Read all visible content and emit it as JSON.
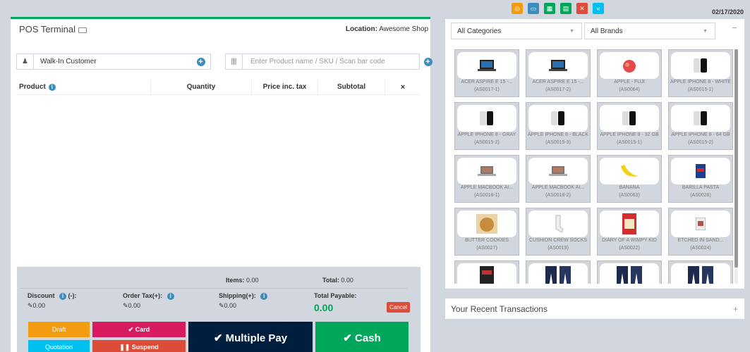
{
  "topbar": {
    "date": "02/17/2020",
    "icons": [
      {
        "name": "calculator-circle-icon",
        "color": "#f39c12",
        "glyph": "◎"
      },
      {
        "name": "window-icon",
        "color": "#3c8dbc",
        "glyph": "▭"
      },
      {
        "name": "calculator-icon",
        "color": "#00a65a",
        "glyph": "▦"
      },
      {
        "name": "briefcase-icon",
        "color": "#00a65a",
        "glyph": "▤"
      },
      {
        "name": "close-window-icon",
        "color": "#dd4b39",
        "glyph": "✕"
      },
      {
        "name": "backward-icon",
        "color": "#00c0ef",
        "glyph": "«"
      }
    ]
  },
  "pos": {
    "title": "POS Terminal",
    "location_label": "Location:",
    "location_value": "Awesome Shop",
    "customer": {
      "value": "Walk-In Customer"
    },
    "product_search": {
      "placeholder": "Enter Product name / SKU / Scan bar code"
    },
    "table_headers": [
      "Product",
      "Quantity",
      "Price inc. tax",
      "Subtotal",
      "×"
    ],
    "items_label": "Items:",
    "items_value": "0.00",
    "total_label": "Total:",
    "total_value": "0.00",
    "discount_label": "Discount",
    "discount_suffix": "(-):",
    "discount_value": "0.00",
    "order_tax_label": "Order Tax(+):",
    "order_tax_value": "0.00",
    "shipping_label": "Shipping(+):",
    "shipping_value": "0.00",
    "total_payable_label": "Total Payable:",
    "total_payable_value": "0.00",
    "cancel_label": "Cancel",
    "buttons": {
      "draft": "Draft",
      "card": "✔ Card",
      "multiple_pay": "✔ Multiple Pay",
      "cash": "✔ Cash",
      "quotation": "Quotation",
      "suspend": "❚❚ Suspend"
    }
  },
  "filters": {
    "categories": "All Categories",
    "brands": "All Brands"
  },
  "products": [
    {
      "name": "ACER ASPIRE E 15 -...",
      "sku": "(AS0017-1)",
      "img": "laptop"
    },
    {
      "name": "ACER ASPIRE E 15 -...",
      "sku": "(AS0017-2)",
      "img": "laptop"
    },
    {
      "name": "APPLE - FUJI",
      "sku": "(AS0064)",
      "img": "apple"
    },
    {
      "name": "APPLE IPHONE 8 - WHITE",
      "sku": "(AS0015-1)",
      "img": "phone"
    },
    {
      "name": "APPLE IPHONE 8 - GRAY",
      "sku": "(AS0015-2)",
      "img": "phone"
    },
    {
      "name": "APPLE IPHONE 8 - BLACK",
      "sku": "(AS0015-3)",
      "img": "phone"
    },
    {
      "name": "APPLE IPHONE 8 - 32 GB",
      "sku": "(AS0015-1)",
      "img": "phone"
    },
    {
      "name": "APPLE IPHONE 8 - 64 GB",
      "sku": "(AS0015-2)",
      "img": "phone"
    },
    {
      "name": "APPLE MACBOOK AI...",
      "sku": "(AS0018-1)",
      "img": "macbook"
    },
    {
      "name": "APPLE MACBOOK AI...",
      "sku": "(AS0018-2)",
      "img": "macbook"
    },
    {
      "name": "BANANA",
      "sku": "(AS0063)",
      "img": "banana"
    },
    {
      "name": "BARILLA PASTA",
      "sku": "(AS0028)",
      "img": "pasta"
    },
    {
      "name": "BUTTER COOKIES",
      "sku": "(AS0027)",
      "img": "cookies"
    },
    {
      "name": "CUSHION CREW SOCKS",
      "sku": "(AS0019)",
      "img": "socks"
    },
    {
      "name": "DIARY OF A WIMPY KID",
      "sku": "(AS0022)",
      "img": "book"
    },
    {
      "name": "ETCHED IN SAND...",
      "sku": "(AS0024)",
      "img": "smallbook"
    },
    {
      "name": "",
      "sku": "",
      "img": "darkbook"
    },
    {
      "name": "",
      "sku": "",
      "img": "jeans"
    },
    {
      "name": "",
      "sku": "",
      "img": "jeans"
    },
    {
      "name": "",
      "sku": "",
      "img": "jeans"
    }
  ],
  "recent": {
    "title": "Your Recent Transactions"
  }
}
